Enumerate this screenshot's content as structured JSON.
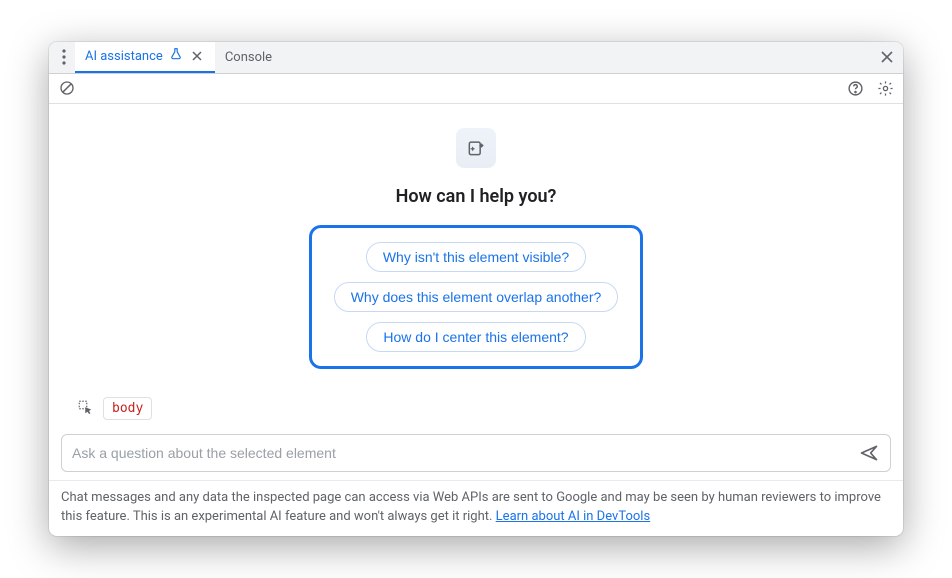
{
  "tabs": {
    "active": "AI assistance",
    "other": "Console"
  },
  "hero": {
    "title": "How can I help you?"
  },
  "suggestions": [
    "Why isn't this element visible?",
    "Why does this element overlap another?",
    "How do I center this element?"
  ],
  "element": {
    "tag": "body"
  },
  "input": {
    "placeholder": "Ask a question about the selected element"
  },
  "footer": {
    "text": "Chat messages and any data the inspected page can access via Web APIs are sent to Google and may be seen by human reviewers to improve this feature. This is an experimental AI feature and won't always get it right. ",
    "link": "Learn about AI in DevTools"
  }
}
